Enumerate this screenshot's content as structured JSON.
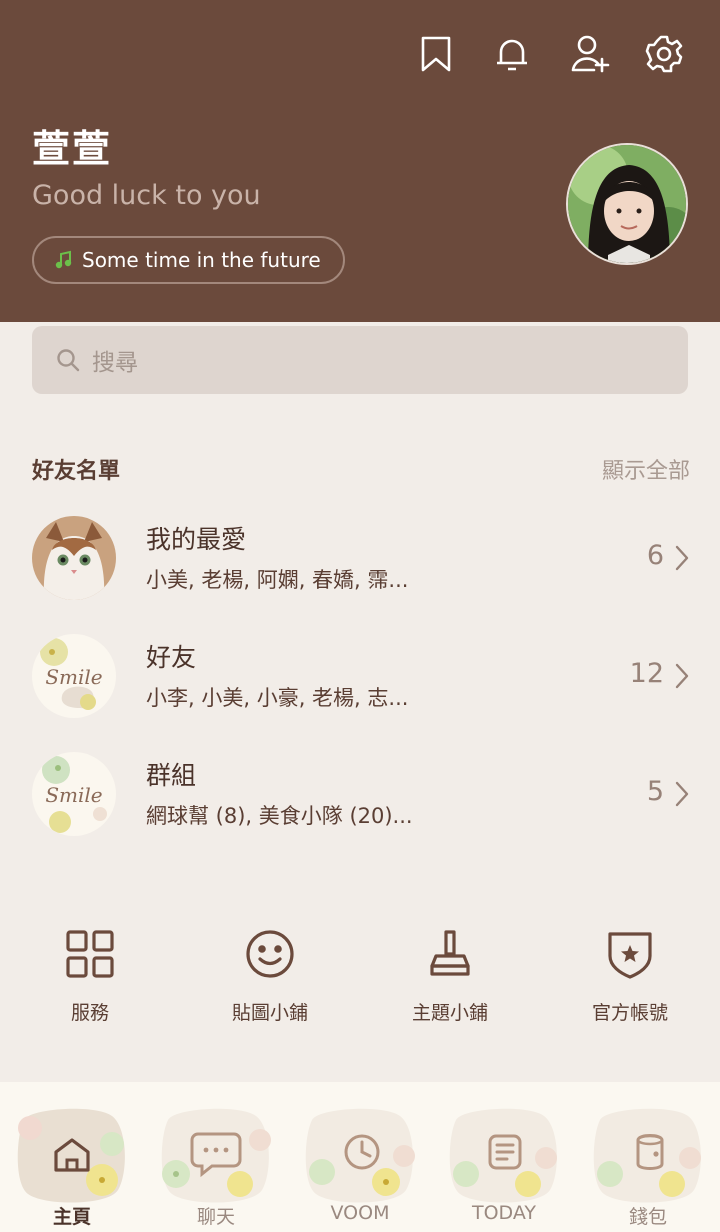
{
  "profile": {
    "name": "萱萱",
    "status": "Good luck to you",
    "music": "Some time in the future"
  },
  "header_icons": [
    "bookmark-icon",
    "bell-icon",
    "add-friend-icon",
    "gear-icon"
  ],
  "search": {
    "placeholder": "搜尋"
  },
  "friends": {
    "title": "好友名單",
    "show_all": "顯示全部",
    "rows": [
      {
        "name": "我的最愛",
        "members": "小美, 老楊, 阿嫻, 春嬌, 霈...",
        "count": "6"
      },
      {
        "name": "好友",
        "members": "小李, 小美, 小豪, 老楊, 志...",
        "count": "12"
      },
      {
        "name": "群組",
        "members": "網球幫 (8), 美食小隊 (20)...",
        "count": "5"
      }
    ]
  },
  "shortcuts": [
    {
      "label": "服務",
      "icon": "grid-icon"
    },
    {
      "label": "貼圖小鋪",
      "icon": "smiley-icon"
    },
    {
      "label": "主題小鋪",
      "icon": "brush-icon"
    },
    {
      "label": "官方帳號",
      "icon": "shield-star-icon"
    }
  ],
  "bottom_nav": [
    {
      "label": "主頁",
      "icon": "home-icon",
      "active": true
    },
    {
      "label": "聊天",
      "icon": "chat-icon",
      "active": false
    },
    {
      "label": "VOOM",
      "icon": "clock-icon",
      "active": false
    },
    {
      "label": "TODAY",
      "icon": "news-icon",
      "active": false
    },
    {
      "label": "錢包",
      "icon": "wallet-icon",
      "active": false
    }
  ],
  "colors": {
    "header_bg": "#6b4a3c",
    "page_bg": "#f2ede8",
    "accent_text": "#5a3e33",
    "music_note": "#6cc04a"
  }
}
